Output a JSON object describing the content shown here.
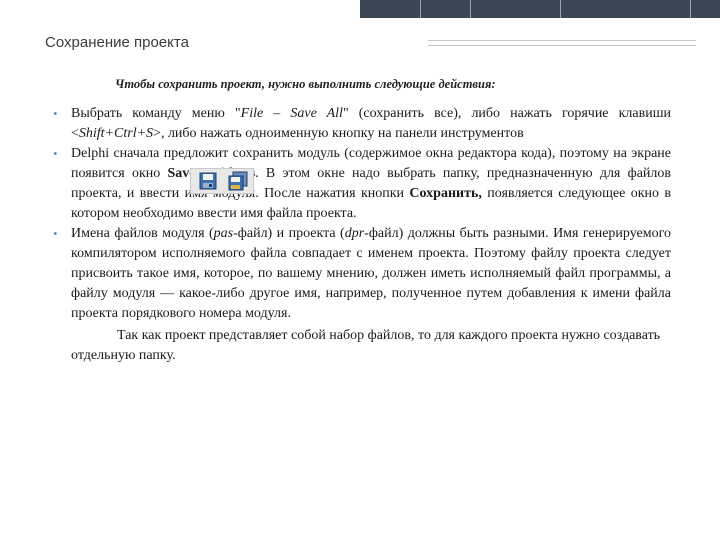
{
  "title": "Сохранение проекта",
  "subtitle": "Чтобы сохранить проект, нужно выполнить следующие действия:",
  "bullets": {
    "b1": {
      "p1": "Выбрать команду меню \"",
      "p2": "File – Save All",
      "p3": "\" (сохранить все), либо нажать горячие клавиши <",
      "p4": "Shift+Ctrl+S",
      "p5": ">, либо нажать одноименную кнопку на панели инструментов"
    },
    "b2": {
      "p1": "Delphi сначала предложит сохранить модуль (содержимое окна редактора кода), поэтому на экране появится окно ",
      "p2": "Save Unitl As",
      "p3": ". В этом окне надо выбрать папку, предназначенную для файлов проекта, и ввести имя модуля. После нажатия кнопки ",
      "p4": "Сохранить,",
      "p5": " появляется следующее окно в котором необходимо ввести имя файла проекта."
    },
    "b3": {
      "p1": "Имена файлов модуля (",
      "p2": "pas",
      "p3": "-файл) и проекта (",
      "p4": "dpr",
      "p5": "-файл) должны быть разными. Имя генерируемого компилятором исполняемого файла совпадает с именем проекта. Поэтому файлу проекта следует присвоить такое имя, которое, по вашему мнению, должен иметь исполняемый файл программы, а файлу модуля — какое-либо другое имя, например, полученное путем добавления к имени файла проекта порядкового номера модуля."
    }
  },
  "closing": "Так как проект представляет собой набор файлов, то для каждого проекта нужно создавать отдельную папку.",
  "icons": {
    "save_icon": "save-icon",
    "save_all_icon": "save-all-icon",
    "bullet_color": "#6a8fb3",
    "topbar_color": "#3b4752"
  }
}
